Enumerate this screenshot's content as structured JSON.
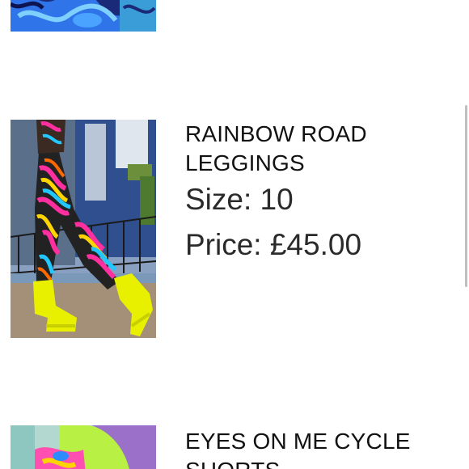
{
  "items": [
    {
      "name": "",
      "image_alt": "Blue printed product photo"
    },
    {
      "name": "RAINBOW ROAD LEGGINGS",
      "size_label": "Size:",
      "size_value": "10",
      "price_label": "Price:",
      "price_value": "£45.00",
      "image_alt": "Model wearing rainbow swirl leggings and neon yellow platform boots"
    },
    {
      "name": "EYES ON ME CYCLE SHORTS",
      "image_alt": "Model with neon green hair wearing colorful outfit"
    }
  ],
  "colors": {
    "text": "#111111",
    "meta_text": "#2a2a2a",
    "neon_yellow": "#e8f000",
    "background": "#ffffff"
  }
}
